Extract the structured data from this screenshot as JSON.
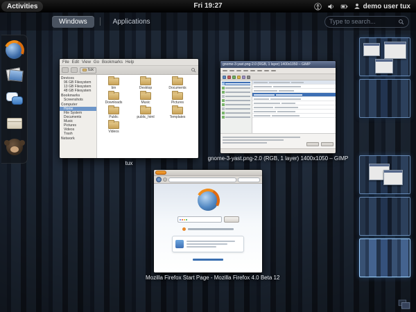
{
  "top_bar": {
    "activities_label": "Activities",
    "clock": "Fri 19:27",
    "user_label": "demo user tux",
    "status_icons": [
      "accessibility",
      "volume",
      "battery"
    ]
  },
  "overview_bar": {
    "tabs": [
      {
        "label": "Windows",
        "active": true
      },
      {
        "label": "Applications",
        "active": false
      }
    ],
    "search_placeholder": "Type to search..."
  },
  "dash": {
    "apps": [
      "firefox",
      "photos",
      "chat",
      "package",
      "monkey"
    ]
  },
  "windows": {
    "files": {
      "caption": "tux",
      "menubar": [
        "File",
        "Edit",
        "View",
        "Go",
        "Bookmarks",
        "Help"
      ],
      "breadcrumb": "tux",
      "sidebar": {
        "sections": [
          {
            "header": "Devices",
            "items": [
              "96 GB Filesystem",
              "13 GB Filesystem",
              "48 GB Filesystem"
            ]
          },
          {
            "header": "Bookmarks",
            "items": [
              "Screenshots"
            ]
          },
          {
            "header": "Computer",
            "items": [
              "Home",
              "File System",
              "Documents",
              "Music",
              "Pictures",
              "Videos",
              "Trash"
            ]
          },
          {
            "header": "Network",
            "items": []
          }
        ],
        "selected_item": "Home"
      },
      "folders": [
        "bin",
        "Desktop",
        "Documents",
        "Downloads",
        "Music",
        "Pictures",
        "Public",
        "public_html",
        "Templates",
        "Videos"
      ]
    },
    "gimp": {
      "caption": "gnome-3-yast.png-2.0 (RGB, 1 layer) 1400x1050 – GIMP"
    },
    "firefox": {
      "caption": "Mozilla Firefox Start Page - Mozilla Firefox 4.0 Beta 12"
    }
  },
  "workspaces": {
    "count": 5
  }
}
